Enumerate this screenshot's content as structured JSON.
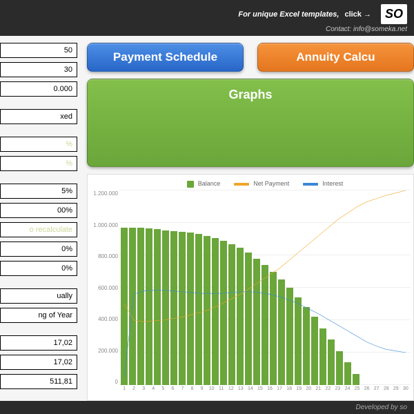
{
  "topbar": {
    "promo": "For unique Excel templates,",
    "promo_cta": "click →",
    "logo": "SO",
    "contact_label": "Contact:",
    "contact_email": "info@someka.net"
  },
  "sidebar": {
    "rows": [
      "50",
      "30",
      "0.000",
      "",
      "xed",
      "",
      "%",
      "%",
      "",
      "5%",
      "00%",
      "o recalculate",
      "0%",
      "0%",
      "",
      "ually",
      "ng of Year",
      "",
      "17,02",
      "17,02",
      "511,81"
    ],
    "grey_indices": [
      3,
      5,
      8,
      14,
      17
    ],
    "faint_indices": [
      6,
      7,
      11
    ]
  },
  "buttons": {
    "schedule": "Payment Schedule",
    "annuity": "Annuity Calcu",
    "graphs": "Graphs"
  },
  "legend": {
    "balance": "Balance",
    "net_payment": "Net Payment",
    "interest": "Interest"
  },
  "colors": {
    "balance": "#6aa63a",
    "net_payment": "#f0a62b",
    "interest": "#3a88d6"
  },
  "footer": "Developed by so",
  "chart_data": {
    "type": "combo",
    "categories": [
      1,
      2,
      3,
      4,
      5,
      6,
      7,
      8,
      9,
      10,
      11,
      12,
      13,
      14,
      15,
      16,
      17,
      18,
      19,
      20,
      21,
      22,
      23,
      24,
      25,
      26,
      27,
      28,
      29,
      30
    ],
    "ylim": [
      0,
      1200000
    ],
    "yticks": [
      0,
      200000,
      400000,
      600000,
      800000,
      1000000,
      1200000
    ],
    "ytick_labels": [
      "0",
      "200.000",
      "400.000",
      "600.000",
      "800.000",
      "1.000.000",
      "1.200.000"
    ],
    "series": [
      {
        "name": "Balance",
        "type": "bar",
        "color": "#6aa63a",
        "values": [
          970000,
          970000,
          970000,
          965000,
          960000,
          955000,
          950000,
          945000,
          940000,
          930000,
          920000,
          905000,
          890000,
          870000,
          845000,
          815000,
          780000,
          740000,
          700000,
          650000,
          600000,
          540000,
          480000,
          420000,
          350000,
          280000,
          210000,
          140000,
          70000,
          0
        ]
      },
      {
        "name": "Net Payment",
        "type": "line",
        "color": "#f0a62b",
        "values": [
          500000,
          400000,
          390000,
          395000,
          400000,
          410000,
          420000,
          435000,
          450000,
          470000,
          500000,
          530000,
          560000,
          600000,
          640000,
          680000,
          720000,
          770000,
          820000,
          870000,
          920000,
          970000,
          1020000,
          1060000,
          1100000,
          1130000,
          1150000,
          1170000,
          1185000,
          1200000
        ]
      },
      {
        "name": "Interest",
        "type": "line",
        "color": "#3a88d6",
        "values": [
          50000,
          560000,
          580000,
          585000,
          585000,
          580000,
          575000,
          570000,
          565000,
          565000,
          565000,
          570000,
          575000,
          575000,
          570000,
          560000,
          545000,
          525000,
          500000,
          470000,
          440000,
          405000,
          370000,
          335000,
          300000,
          265000,
          240000,
          220000,
          210000,
          200000
        ]
      }
    ]
  }
}
